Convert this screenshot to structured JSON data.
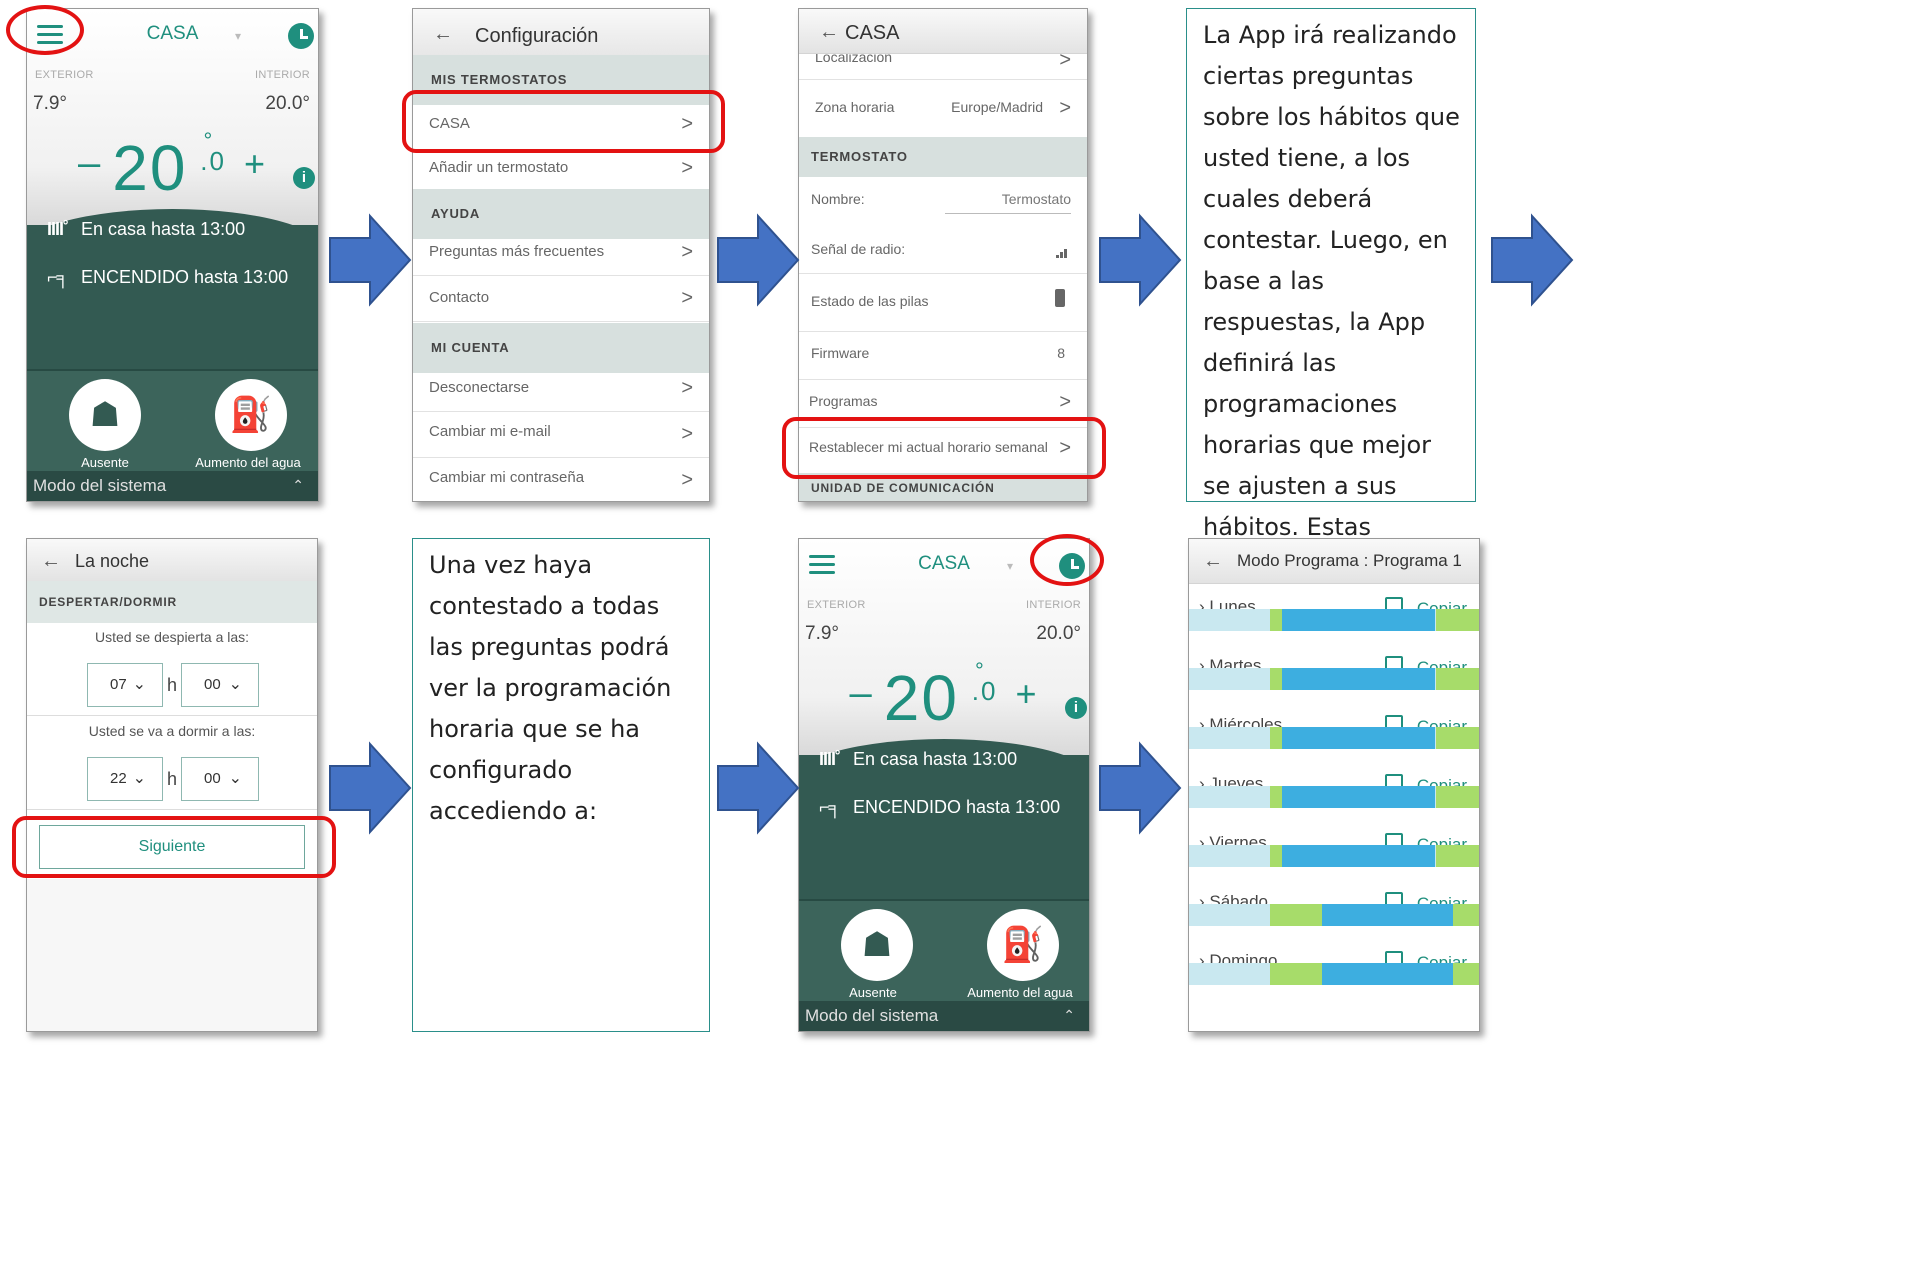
{
  "home": {
    "title": "CASA",
    "caret": "▾",
    "exterior_label": "EXTERIOR",
    "interior_label": "INTERIOR",
    "exterior_temp": "7.9°",
    "interior_temp": "20.0°",
    "minus": "–",
    "setpoint_int": "20",
    "setpoint_sep": "°",
    "setpoint_dec": ".0",
    "plus": "+",
    "info": "i",
    "status_heating": "En casa hasta 13:00",
    "status_water": "ENCENDIDO hasta 13:00",
    "btn_away": "Ausente",
    "btn_hot_water": "Aumento del agua caliente",
    "mode_bar": "Modo del sistema",
    "mode_chevron": "⌃"
  },
  "config": {
    "back": "←",
    "title": "Configuración",
    "sec_thermostats": "MIS TERMOSTATOS",
    "item_casa": "CASA",
    "item_add": "Añadir un termostato",
    "sec_help": "AYUDA",
    "item_faq": "Preguntas más frecuentes",
    "item_contact": "Contacto",
    "sec_account": "MI CUENTA",
    "item_logout": "Desconectarse",
    "item_email": "Cambiar mi e-mail",
    "item_password": "Cambiar mi contraseña",
    "chev": ">"
  },
  "casa_settings": {
    "back": "←",
    "title": "CASA",
    "item_location": "Localización",
    "item_timezone": "Zona horaria",
    "timezone_value": "Europe/Madrid",
    "sec_thermostat": "TERMOSTATO",
    "name_label": "Nombre:",
    "name_value": "Termostato",
    "radio_label": "Señal de radio:",
    "battery_label": "Estado de las pilas",
    "firmware_label": "Firmware",
    "firmware_value": "8",
    "programs_label": "Programas",
    "reset_label": "Restablecer mi actual horario semanal",
    "sec_comm": "UNIDAD DE COMUNICACIÓN",
    "chev": ">"
  },
  "text_top": "La App irá realizando ciertas preguntas sobre los hábitos que usted tiene, a los cuales deberá contestar. Luego, en base a las respuestas, la App definirá las programaciones horarias que mejor se ajusten a sus hábitos. Estas programaciones se podrán modificar manualmente más adelante.",
  "night": {
    "back": "←",
    "title": "La noche",
    "section": "DESPERTAR/DORMIR",
    "wake_question": "Usted se despierta a las:",
    "wake_hour": "07",
    "wake_min": "00",
    "sleep_question": "Usted se va a dormir a las:",
    "sleep_hour": "22",
    "sleep_min": "00",
    "h": "h",
    "caret": "⌄",
    "next": "Siguiente"
  },
  "text_bottom": "Una vez haya contestado a todas las preguntas podrá ver la programación horaria que se ha configurado accediendo a:",
  "program": {
    "back": "←",
    "title": "Modo Programa : Programa 1",
    "copy": "Copiar",
    "chev": "›",
    "days": [
      {
        "name": "Lunes"
      },
      {
        "name": "Martes"
      },
      {
        "name": "Miércoles"
      },
      {
        "name": "Jueves"
      },
      {
        "name": "Viernes"
      },
      {
        "name": "Sábado"
      },
      {
        "name": "Domingo"
      }
    ],
    "colors": {
      "away": "#c9e8f0",
      "home": "#3daee0",
      "comfort": "#a7dc6a"
    }
  },
  "colors": {
    "accent": "#1f8f7e",
    "dark": "#335a52",
    "highlight": "#e31212",
    "arrow": "#4472c4"
  }
}
